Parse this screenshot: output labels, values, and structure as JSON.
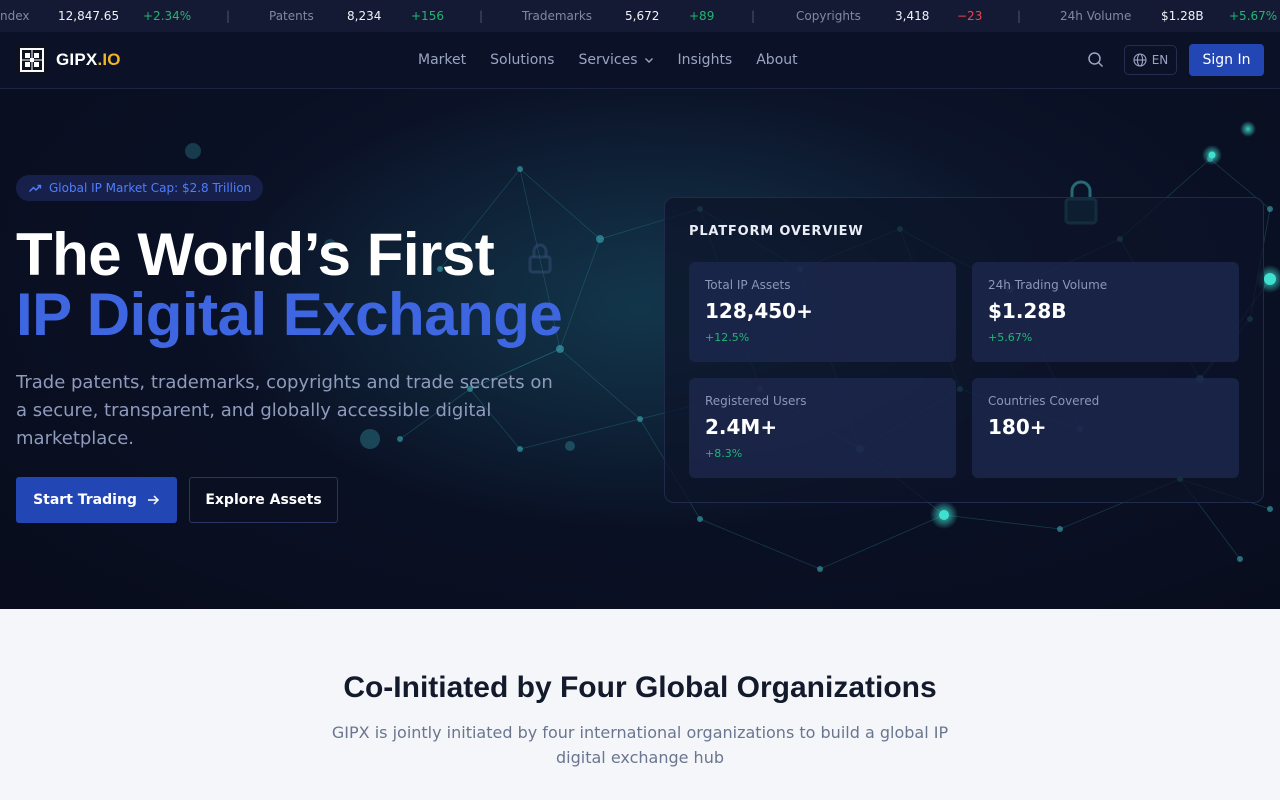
{
  "ticker": {
    "items": [
      {
        "label": "ndex",
        "value": "12,847.65",
        "change": "+2.34%",
        "dir": "up"
      },
      {
        "label": "Patents",
        "value": "8,234",
        "change": "+156",
        "dir": "up"
      },
      {
        "label": "Trademarks",
        "value": "5,672",
        "change": "+89",
        "dir": "up"
      },
      {
        "label": "Copyrights",
        "value": "3,418",
        "change": "−23",
        "dir": "down"
      },
      {
        "label": "24h Volume",
        "value": "$1.28B",
        "change": "+5.67%",
        "dir": "up"
      }
    ],
    "separator": "|"
  },
  "nav": {
    "logo_main": "GIPX",
    "logo_accent": ".IO",
    "links": [
      "Market",
      "Solutions",
      "Services",
      "Insights",
      "About"
    ],
    "language": "EN",
    "signin": "Sign In"
  },
  "hero": {
    "badge": "Global IP Market Cap: $2.8 Trillion",
    "title_line1": "The World’s First",
    "title_line2": "IP Digital Exchange",
    "subtitle": "Trade patents, trademarks, copyrights and trade secrets on a secure, transparent, and globally accessible digital marketplace.",
    "cta_primary": "Start Trading",
    "cta_secondary": "Explore Assets"
  },
  "overview": {
    "title": "PLATFORM OVERVIEW",
    "stats": [
      {
        "label": "Total IP Assets",
        "value": "128,450+",
        "change": "+12.5%"
      },
      {
        "label": "24h Trading Volume",
        "value": "$1.28B",
        "change": "+5.67%"
      },
      {
        "label": "Registered Users",
        "value": "2.4M+",
        "change": "+8.3%"
      },
      {
        "label": "Countries Covered",
        "value": "180+",
        "change": ""
      }
    ]
  },
  "orgs": {
    "title": "Co-Initiated by Four Global Organizations",
    "subtitle": "GIPX is jointly initiated by four international organizations to build a global IP digital exchange hub"
  },
  "colors": {
    "accent": "#2346b5",
    "title_blue": "#3e66e0",
    "logo_gold": "#f0b429",
    "up": "#22b573",
    "down": "#e5484d",
    "teal_glow": "#3fe0d0"
  },
  "icons": [
    "trend-up-icon",
    "search-icon",
    "globe-icon",
    "chevron-down-icon",
    "arrow-right-icon",
    "lock-icon",
    "logo-mark"
  ]
}
